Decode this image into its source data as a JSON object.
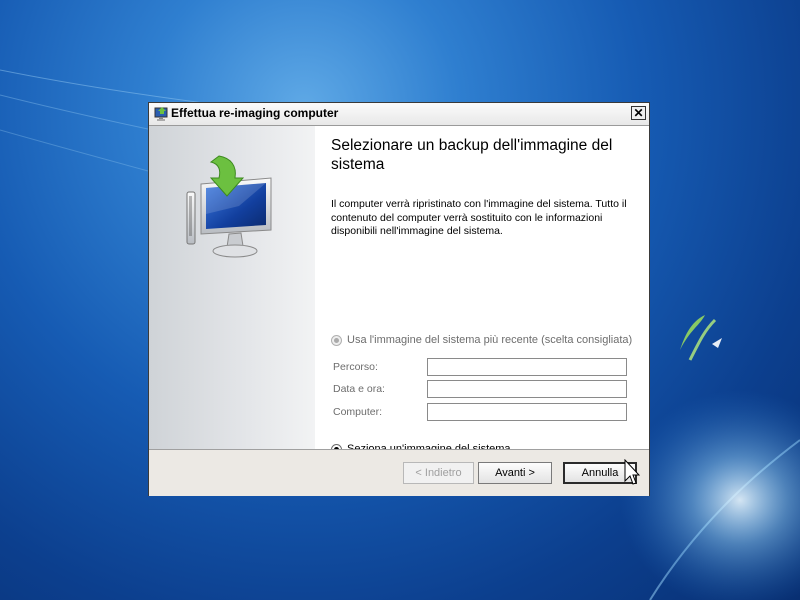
{
  "window": {
    "title": "Effettua re-imaging computer",
    "close_glyph": "✕"
  },
  "content": {
    "heading": "Selezionare un backup dell'immagine del sistema",
    "description": "Il computer verrà ripristinato con l'immagine del sistema. Tutto il contenuto del computer verrà sostituito con le informazioni disponibili nell'immagine del sistema."
  },
  "options": {
    "use_latest": {
      "label": "Usa l'immagine del sistema più recente (scelta consigliata)",
      "selected": false,
      "enabled": false
    },
    "select_image": {
      "label": "Seziona un'immagine del sistema",
      "selected": true,
      "enabled": true
    }
  },
  "fields": [
    {
      "label": "Percorso:",
      "value": ""
    },
    {
      "label": "Data e ora:",
      "value": ""
    },
    {
      "label": "Computer:",
      "value": ""
    }
  ],
  "buttons": {
    "back": "< Indietro",
    "next": "Avanti >",
    "cancel": "Annulla"
  },
  "icons": {
    "title": "restore-computer-icon",
    "art": "monitor-restore-icon",
    "cursor": "mouse-pointer-icon"
  },
  "colors": {
    "desktop_dark": "#082f72",
    "desktop_light": "#5fa9e6",
    "arrow_green": "#6cc040"
  }
}
